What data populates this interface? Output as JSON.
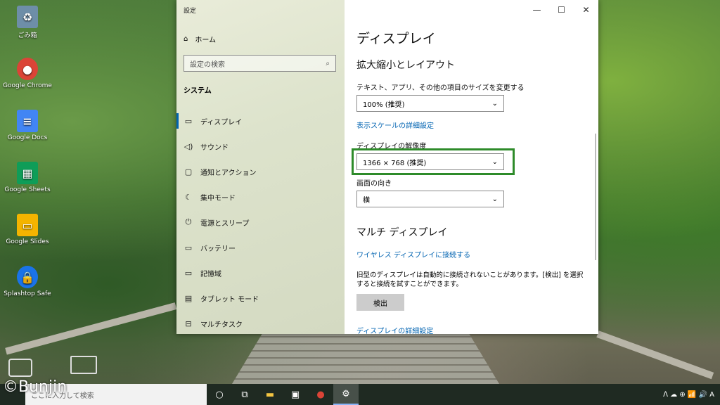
{
  "desktop": {
    "icons": [
      {
        "name": "ごみ箱",
        "color": "#6e8ea8"
      },
      {
        "name": "Google Chrome",
        "color": "#db4437"
      },
      {
        "name": "Google Docs",
        "color": "#4285f4"
      },
      {
        "name": "Google Sheets",
        "color": "#0f9d58"
      },
      {
        "name": "Google Slides",
        "color": "#f4b400"
      },
      {
        "name": "Splashtop Safe",
        "color": "#1a73e8"
      }
    ],
    "watermark": "©Bunjin"
  },
  "window": {
    "title": "設定",
    "caption": {
      "minimize": "—",
      "maximize": "☐",
      "close": "✕"
    }
  },
  "sidebar": {
    "home": "ホーム",
    "search_placeholder": "設定の検索",
    "section": "システム",
    "items": [
      {
        "label": "ディスプレイ",
        "icon": "▭"
      },
      {
        "label": "サウンド",
        "icon": "🔈"
      },
      {
        "label": "通知とアクション",
        "icon": "▢"
      },
      {
        "label": "集中モード",
        "icon": "☾"
      },
      {
        "label": "電源とスリープ",
        "icon": "⏻"
      },
      {
        "label": "バッテリー",
        "icon": "▭"
      },
      {
        "label": "記憶域",
        "icon": "▭"
      },
      {
        "label": "タブレット モード",
        "icon": "▤"
      },
      {
        "label": "マルチタスク",
        "icon": "⊟"
      }
    ]
  },
  "main": {
    "title": "ディスプレイ",
    "scale_section": "拡大縮小とレイアウト",
    "text_size_label": "テキスト、アプリ、その他の項目のサイズを変更する",
    "text_size_value": "100% (推奨)",
    "advanced_scaling_link": "表示スケールの詳細設定",
    "resolution_label": "ディスプレイの解像度",
    "resolution_value": "1366 × 768 (推奨)",
    "orientation_label": "画面の向き",
    "orientation_value": "横",
    "multi_display_section": "マルチ ディスプレイ",
    "wireless_link": "ワイヤレス ディスプレイに接続する",
    "detect_text": "旧型のディスプレイは自動的に接続されないことがあります。[検出] を選択すると接続を試すことができます。",
    "detect_button": "検出",
    "advanced_display_link": "ディスプレイの詳細設定",
    "highlight_color": "#2e8b2a"
  },
  "taskbar": {
    "search_text": "ここに入力して検索",
    "items": [
      "○",
      "⧉",
      "📁",
      "🛍",
      "●",
      "⚙"
    ],
    "tray": "ᐱ ☁ ⊕ 📶 🔊 A"
  }
}
